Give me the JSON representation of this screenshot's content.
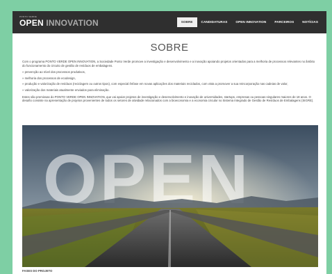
{
  "header": {
    "logo_small": "PONTO VERDE",
    "logo_word1": "OPEN",
    "logo_word2": "INNOVATION",
    "nav": [
      "SOBRE",
      "CANDIDATURAS",
      "OPEN INNOVATION",
      "PARCEIROS",
      "NOTÍCIAS"
    ]
  },
  "page": {
    "title": "SOBRE",
    "intro": "Com o programa PONTO VERDE OPEN INNOVATION, a Sociedade Ponto Verde promove a investigação e desenvolvimento e a inovação apoiando projetos orientados para a melhoria de processos relevantes no âmbito do funcionamento do circuito de gestão de resíduos de embalagens.",
    "bullets": [
      "» prevenção ao nível dos processos produtivos,",
      "» melhoria dos processos de ecodesign,",
      "» produção e valorização de resíduos (reciclagem ou outros tipos), com especial ênfase em novas aplicações dos materiais reciclados, com vista a promover a sua reincorporação nas cadeias de valor,",
      "» valorização dos materiais atualmente enviados para eliminação."
    ],
    "closing": "Estes são premissas do PONTO VERDE OPEN INNOVATION, que vai apoiar projetos de investigação e desenvolvimento e inovação de universidades, startups, empresas ou pessoas singulares maiores de 18 anos. O desafio consiste na apresentação de projetos provenientes de todos os setores de atividade relacionados com a bioeconomia e a economia circular no Sistema Integrado de Gestão de Resíduos de Embalagens (SIGRE).",
    "hero_text": "OPEN",
    "section_label": "FASES DO PROJETO"
  },
  "colors": {
    "background": "#7ecfa4",
    "navbar": "#2f2f2f",
    "active_tab": "#f0f0f0"
  }
}
